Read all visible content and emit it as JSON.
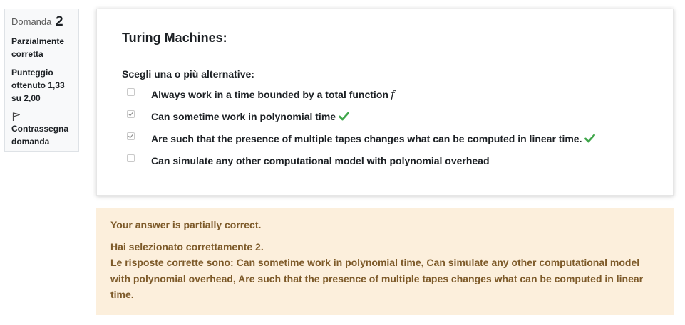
{
  "info": {
    "question_label": "Domanda",
    "question_number": "2",
    "state": "Parzialmente corretta",
    "grade": "Punteggio ottenuto 1,33 su 2,00",
    "flag_label": "Contrassegna domanda",
    "flag_icon": "flag-icon"
  },
  "question": {
    "text": "Turing Machines:",
    "prompt": "Scegli una o più alternative:",
    "answers": [
      {
        "label": "Always work in a time bounded by a total function",
        "math": "f",
        "checked": false,
        "correct_mark": false
      },
      {
        "label": "Can sometime work in polynomial time",
        "checked": true,
        "correct_mark": true
      },
      {
        "label": "Are such that the presence of multiple tapes changes what can be computed in linear time.",
        "checked": true,
        "correct_mark": true
      },
      {
        "label": "Can simulate any other computational model with polynomial overhead",
        "checked": false,
        "correct_mark": false
      }
    ]
  },
  "feedback": {
    "general": "Your answer is partially correct.",
    "num_correct": "Hai selezionato correttamente 2.",
    "right_answer": "Le risposte corrette sono: Can sometime work in polynomial time, Can simulate any other computational model with polynomial overhead, Are such that the presence of multiple tapes changes what can be computed in linear time."
  },
  "colors": {
    "correct_tick": "#3fa64a",
    "feedback_bg": "#fcefdc",
    "feedback_text": "#7d5a29",
    "checkbox_checked": "#8e8e8e"
  }
}
